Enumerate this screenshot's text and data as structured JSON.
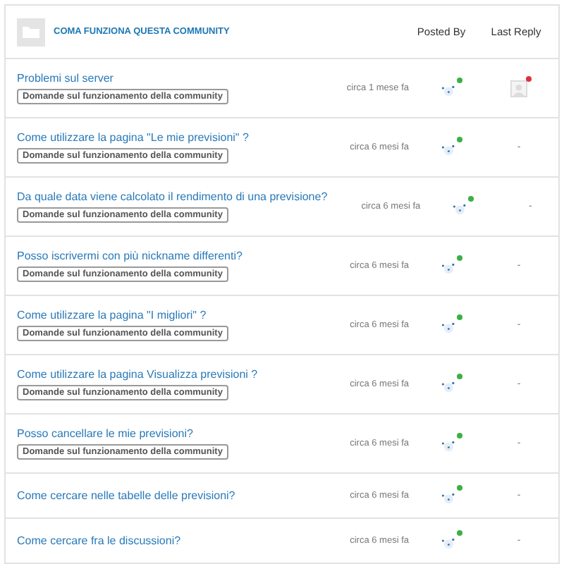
{
  "header": {
    "title": "COMA FUNZIONA QUESTA COMMUNITY",
    "columns": [
      "Posted By",
      "Last Reply"
    ]
  },
  "topics": [
    {
      "title": "Problemi sul server",
      "tag": "Domande sul funzionamento della community",
      "time": "circa 1 mese fa",
      "posted_by": {
        "color": "#3cb043"
      },
      "last_reply": {
        "kind": "avatar",
        "color": "#e0303a"
      }
    },
    {
      "title": "Come utilizzare la pagina \"Le mie previsioni\" ?",
      "tag": "Domande sul funzionamento della community",
      "time": "circa 6 mesi fa",
      "posted_by": {
        "color": "#3cb043"
      },
      "last_reply": {
        "kind": "text",
        "text": "-"
      }
    },
    {
      "title": "Da quale data viene calcolato il rendimento di una previsione?",
      "tag": "Domande sul funzionamento della community",
      "time": "circa 6 mesi fa",
      "posted_by": {
        "color": "#3cb043"
      },
      "last_reply": {
        "kind": "text",
        "text": "-"
      }
    },
    {
      "title": "Posso iscrivermi con più nickname differenti?",
      "tag": "Domande sul funzionamento della community",
      "time": "circa 6 mesi fa",
      "posted_by": {
        "color": "#3cb043"
      },
      "last_reply": {
        "kind": "text",
        "text": "-"
      }
    },
    {
      "title": "Come utilizzare la pagina \"I migliori\" ?",
      "tag": "Domande sul funzionamento della community",
      "time": "circa 6 mesi fa",
      "posted_by": {
        "color": "#3cb043"
      },
      "last_reply": {
        "kind": "text",
        "text": "-"
      }
    },
    {
      "title": "Come utilizzare la pagina Visualizza previsioni ?",
      "tag": "Domande sul funzionamento della community",
      "time": "circa 6 mesi fa",
      "posted_by": {
        "color": "#3cb043"
      },
      "last_reply": {
        "kind": "text",
        "text": "-"
      }
    },
    {
      "title": "Posso cancellare le mie previsioni?",
      "tag": "Domande sul funzionamento della community",
      "time": "circa 6 mesi fa",
      "posted_by": {
        "color": "#3cb043"
      },
      "last_reply": {
        "kind": "text",
        "text": "-"
      }
    },
    {
      "title": "Come cercare nelle tabelle delle previsioni?",
      "time": "circa 6 mesi fa",
      "posted_by": {
        "color": "#3cb043"
      },
      "last_reply": {
        "kind": "text",
        "text": "-"
      }
    },
    {
      "title": "Come cercare fra le discussioni?",
      "time": "circa 6 mesi fa",
      "posted_by": {
        "color": "#3cb043"
      },
      "last_reply": {
        "kind": "text",
        "text": "-"
      }
    }
  ]
}
